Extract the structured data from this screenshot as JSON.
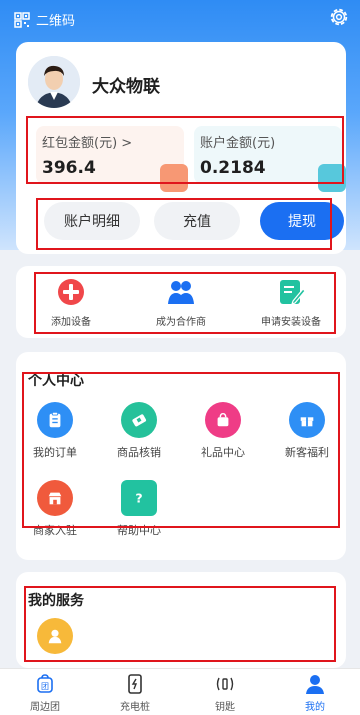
{
  "header": {
    "qr_label": "二维码"
  },
  "profile": {
    "name": "大众物联",
    "red_packet": {
      "label": "红包金额(元) >",
      "value": "396.4"
    },
    "account": {
      "label": "账户金额(元)",
      "value": "0.2184"
    }
  },
  "buttons": {
    "detail": "账户明细",
    "recharge": "充值",
    "withdraw": "提现"
  },
  "actions": [
    {
      "label": "添加设备",
      "icon": "plus-circle-icon",
      "color": "#f0474a"
    },
    {
      "label": "成为合作商",
      "icon": "partners-icon",
      "color": "#1b6ff2"
    },
    {
      "label": "申请安装设备",
      "icon": "edit-document-icon",
      "color": "#22c2a0"
    }
  ],
  "personal_center": {
    "title": "个人中心",
    "items": [
      {
        "label": "我的订单",
        "icon": "clipboard-icon",
        "color": "#2e8ff5"
      },
      {
        "label": "商品核销",
        "icon": "ticket-icon",
        "color": "#25c19a"
      },
      {
        "label": "礼品中心",
        "icon": "gift-bag-icon",
        "color": "#ef3c86"
      },
      {
        "label": "新客福利",
        "icon": "gift-box-icon",
        "color": "#2e8ff5"
      },
      {
        "label": "商家入驻",
        "icon": "store-icon",
        "color": "#f05a3c"
      },
      {
        "label": "帮助中心",
        "icon": "help-icon",
        "color": "#22c2a0"
      }
    ]
  },
  "services": {
    "title": "我的服务",
    "items": [
      {
        "icon": "service-person-icon",
        "color": "#f7b93a"
      }
    ]
  },
  "tabbar": [
    {
      "label": "周边团"
    },
    {
      "label": "充电桩"
    },
    {
      "label": "钥匙"
    },
    {
      "label": "我的"
    }
  ],
  "colors": {
    "accent": "#1b6ff2",
    "highlight": "#e0151c"
  }
}
